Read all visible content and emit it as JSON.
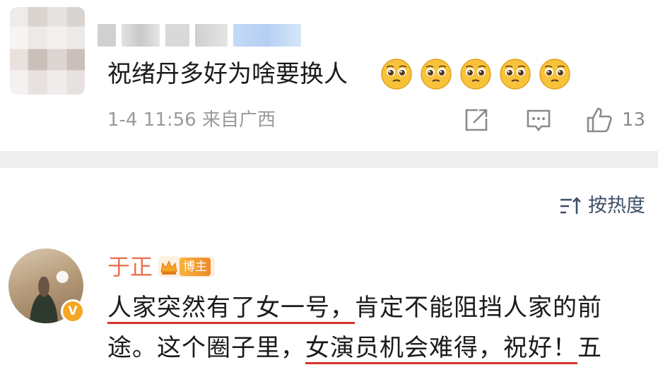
{
  "first_comment": {
    "text": "祝绪丹多好为啥要换人",
    "emoji_count": 5,
    "emoji_icon": "pleading-face-icon",
    "timestamp": "1-4 11:56",
    "location": "来自广西",
    "like_count": "13",
    "actions": [
      "share-icon",
      "comment-icon",
      "like-icon"
    ]
  },
  "sort": {
    "label": "按热度",
    "icon": "sort-icon"
  },
  "main_comment": {
    "author": "于正",
    "badge": "博主",
    "verified_mark": "V",
    "lines": [
      {
        "a": "人家突然有了女一号，",
        "b": "肯定不能阻挡人家的前"
      },
      {
        "a": "途。这个圈子里，",
        "b": "女演员机会难得，祝好！",
        "c": "五"
      }
    ]
  },
  "colors": {
    "author_orange": "#eb7350",
    "underline_red": "#d8322c",
    "link_blue": "#3d4f66",
    "meta_gray": "#9a9a9a",
    "separator": "#eeeeee"
  }
}
